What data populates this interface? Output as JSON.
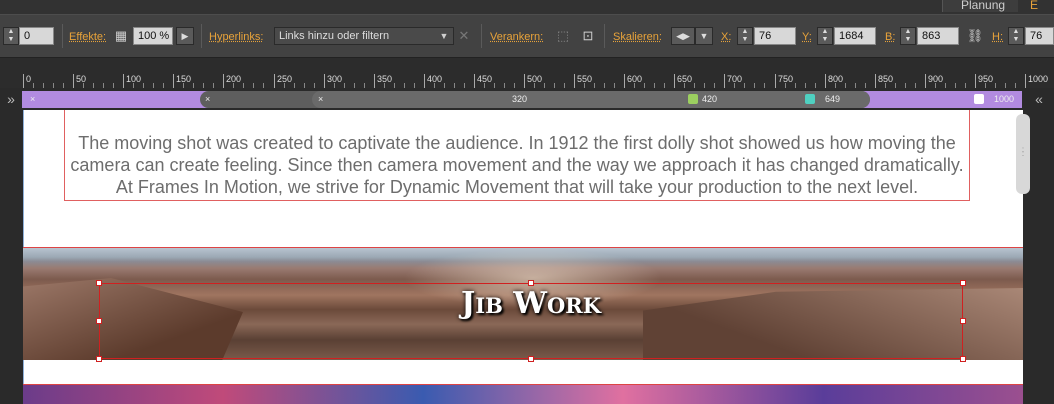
{
  "workspace": {
    "tab_planung": "Planung",
    "tab_next": "E"
  },
  "toolbar": {
    "rotation_value": "0",
    "effekte_label": "Effekte:",
    "opacity_value": "100 %",
    "hyperlinks_label": "Hyperlinks:",
    "hyperlinks_placeholder": "Links hinzu oder filtern",
    "verankern_label": "Verankern:",
    "skalieren_label": "Skalieren:",
    "x_label": "X:",
    "x_value": "76",
    "y_label": "Y:",
    "y_value": "1684",
    "b_label": "B:",
    "b_value": "863",
    "h_label": "H:",
    "h_value": "76"
  },
  "ruler": {
    "labels": [
      "0",
      "50",
      "100",
      "150",
      "200",
      "250",
      "300",
      "350",
      "400",
      "450",
      "500",
      "550",
      "600",
      "650",
      "700",
      "750",
      "800",
      "850",
      "900",
      "950",
      "1000"
    ]
  },
  "breakpoints": {
    "marker_320": "320",
    "marker_420": "420",
    "marker_649": "649",
    "marker_1000": "1000",
    "close_symbol": "×"
  },
  "page": {
    "intro_text": "The moving shot was created to captivate the audience. In 1912 the first dolly shot showed us how  moving the camera can create feeling. Since then camera movement and the way we approach it has changed dramatically. At Frames In Motion, we strive for Dynamic Movement that will take your production to the next level.",
    "jib_title": "Jib Work"
  },
  "colors": {
    "accent_label": "#e8a33a",
    "breakpoint_bar": "#b28be0",
    "selection": "#d02020"
  }
}
